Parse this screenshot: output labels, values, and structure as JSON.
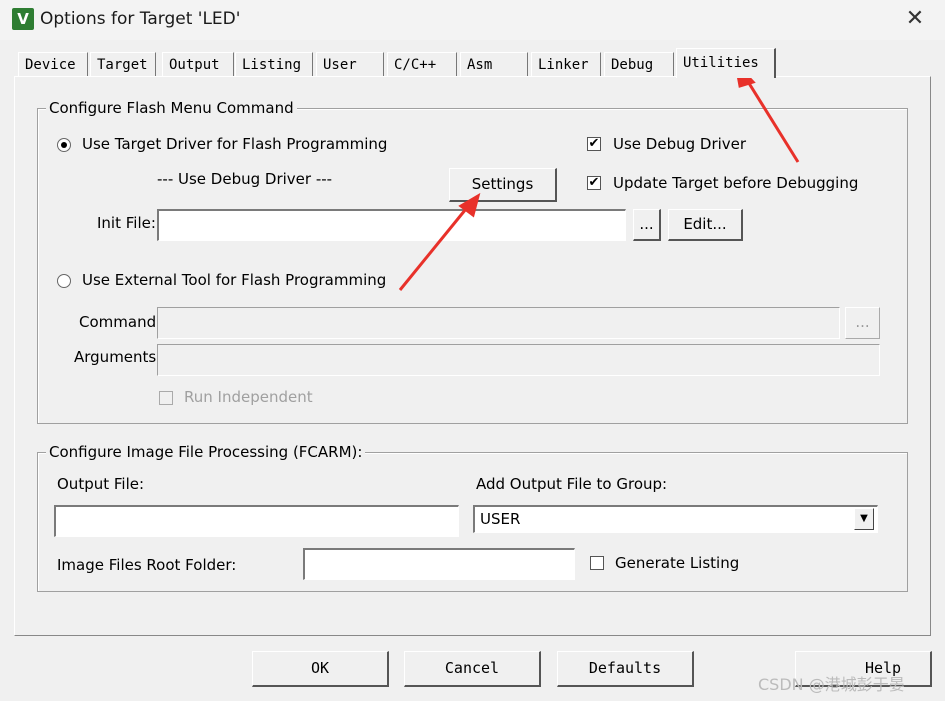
{
  "window": {
    "title": "Options for Target 'LED'",
    "close_glyph": "✕",
    "app_icon_glyph": "V"
  },
  "tabs": [
    "Device",
    "Target",
    "Output",
    "Listing",
    "User",
    "C/C++",
    "Asm",
    "Linker",
    "Debug",
    "Utilities"
  ],
  "active_tab": "Utilities",
  "flash_group": {
    "title": "Configure Flash Menu Command",
    "use_target_driver_label": "Use Target Driver for Flash Programming",
    "use_target_driver_selected": true,
    "driver_text": "--- Use Debug Driver ---",
    "settings_label": "Settings",
    "use_debug_driver_label": "Use Debug Driver",
    "use_debug_driver_checked": true,
    "update_target_label": "Update Target before Debugging",
    "update_target_checked": true,
    "init_file_label": "Init File:",
    "init_file_value": "",
    "browse_label": "...",
    "edit_label": "Edit...",
    "use_external_label": "Use External Tool for Flash Programming",
    "use_external_selected": false,
    "command_label": "Command:",
    "command_value": "",
    "command_browse_label": "...",
    "arguments_label": "Arguments:",
    "arguments_value": "",
    "run_independent_label": "Run Independent",
    "run_independent_checked": false
  },
  "image_group": {
    "title": "Configure Image File Processing (FCARM):",
    "output_file_label": "Output File:",
    "output_file_value": "",
    "add_output_label": "Add Output File  to Group:",
    "group_selected": "USER",
    "root_folder_label": "Image Files Root Folder:",
    "root_folder_value": "",
    "generate_listing_label": "Generate Listing",
    "generate_listing_checked": false
  },
  "footer": {
    "ok": "OK",
    "cancel": "Cancel",
    "defaults": "Defaults",
    "help": "Help"
  },
  "watermark": "CSDN @港城彭于晏",
  "check_glyph": "✔",
  "colors": {
    "annotation_arrow": "#e8312a",
    "app_icon_bg": "#2e7d32"
  }
}
